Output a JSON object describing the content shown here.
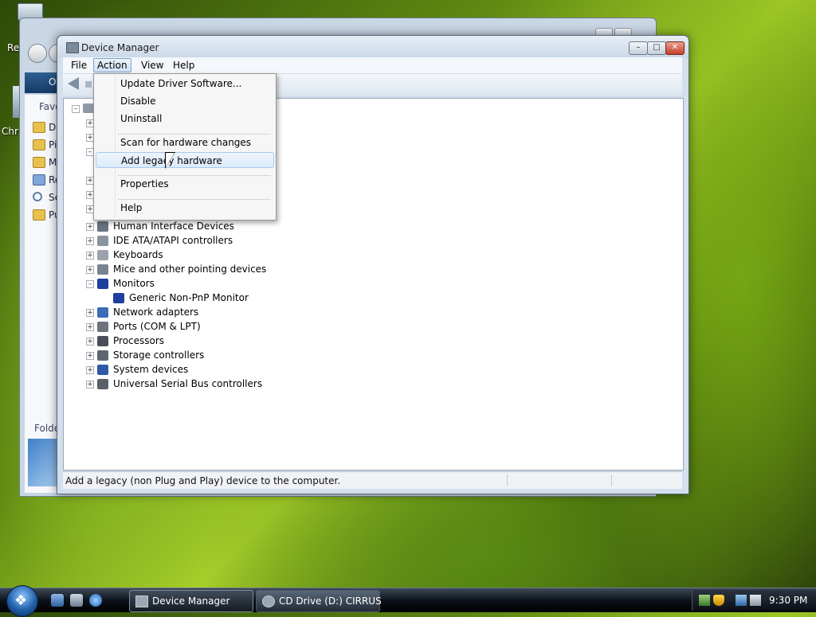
{
  "desktop": {
    "icon_labels": [
      "Re",
      "Chr"
    ]
  },
  "background_window": {
    "bar_label": "O",
    "favorites_label": "Favor",
    "side_items": [
      "Do",
      "Pi",
      "M",
      "Re",
      "Se",
      "Pu"
    ],
    "folders_label": "Folde"
  },
  "window": {
    "title": "Device Manager",
    "controls": {
      "minimize": "–",
      "maximize": "□",
      "close": "✕"
    },
    "menu": {
      "file": "File",
      "action": "Action",
      "view": "View",
      "help": "Help"
    },
    "status_text": "Add a legacy (non Plug and Play) device to the computer."
  },
  "tree": [
    {
      "label": "Human Interface Devices",
      "expander": "+",
      "icon": "hid-icon",
      "color": "#6b7480"
    },
    {
      "label": "IDE ATA/ATAPI controllers",
      "expander": "+",
      "icon": "ide-controller-icon",
      "color": "#8a949f"
    },
    {
      "label": "Keyboards",
      "expander": "+",
      "icon": "keyboard-icon",
      "color": "#9aa3ad"
    },
    {
      "label": "Mice and other pointing devices",
      "expander": "+",
      "icon": "mouse-icon",
      "color": "#7a8390"
    },
    {
      "label": "Monitors",
      "expander": "–",
      "icon": "monitor-icon",
      "color": "#1d3f9e"
    },
    {
      "label": "Generic Non-PnP Monitor",
      "expander": "",
      "icon": "monitor-icon",
      "color": "#1d3f9e",
      "child": true
    },
    {
      "label": "Network adapters",
      "expander": "+",
      "icon": "network-adapter-icon",
      "color": "#3c6bb8"
    },
    {
      "label": "Ports (COM & LPT)",
      "expander": "+",
      "icon": "port-icon",
      "color": "#6d737b"
    },
    {
      "label": "Processors",
      "expander": "+",
      "icon": "processor-icon",
      "color": "#4a4f57"
    },
    {
      "label": "Storage controllers",
      "expander": "+",
      "icon": "storage-controller-icon",
      "color": "#5f6670"
    },
    {
      "label": "System devices",
      "expander": "+",
      "icon": "system-device-icon",
      "color": "#2e5aa8"
    },
    {
      "label": "Universal Serial Bus controllers",
      "expander": "+",
      "icon": "usb-icon",
      "color": "#5a6069"
    }
  ],
  "action_menu": [
    {
      "label": "Update Driver Software...",
      "name": "menu-update-driver-software"
    },
    {
      "label": "Disable",
      "name": "menu-disable"
    },
    {
      "label": "Uninstall",
      "name": "menu-uninstall"
    },
    {
      "label": "Scan for hardware changes",
      "name": "menu-scan-for-hardware-changes"
    },
    {
      "label": "Add legacy hardware",
      "name": "menu-add-legacy-hardware",
      "hover": true
    },
    {
      "label": "Properties",
      "name": "menu-properties"
    },
    {
      "label": "Help",
      "name": "menu-help"
    }
  ],
  "taskbar": {
    "start_glyph": "❖",
    "buttons": [
      {
        "label": "Device Manager",
        "active": true
      },
      {
        "label": "CD Drive (D:) CIRRUS",
        "active": false
      }
    ],
    "clock": "9:30 PM"
  }
}
